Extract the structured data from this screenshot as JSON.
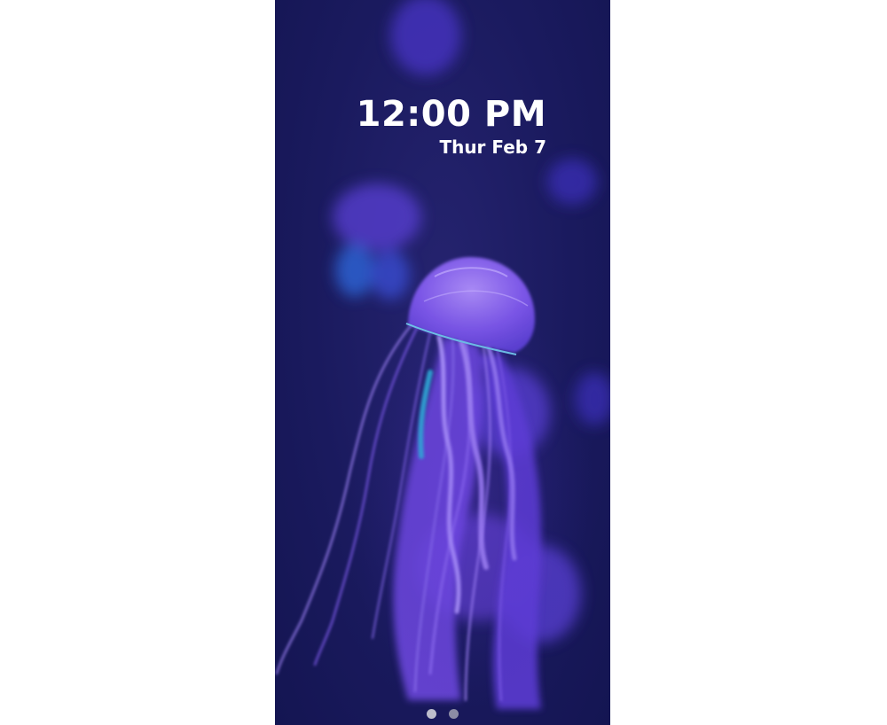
{
  "lock_screen": {
    "time": "12:00 PM",
    "date": "Thur Feb 7"
  },
  "wallpaper": {
    "subject": "jellyfish-icon",
    "background_color": "#1a1a5e",
    "accent_color": "#7a4ee0"
  },
  "pager": {
    "pages": [
      {
        "label": "page-1",
        "active": true
      },
      {
        "label": "page-2",
        "active": false
      }
    ]
  }
}
